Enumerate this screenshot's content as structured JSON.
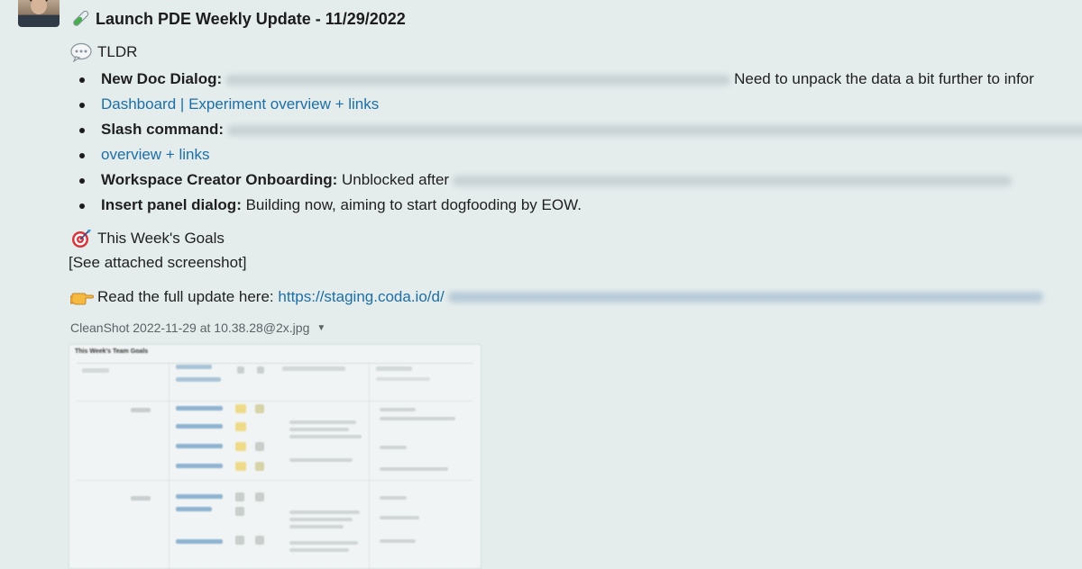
{
  "header": {
    "title": "Launch PDE Weekly Update - 11/29/2022",
    "icon": "test-tube-icon"
  },
  "tldr": {
    "label": "TLDR",
    "icon": "speech-balloon-icon"
  },
  "bullets": [
    {
      "label": "New Doc Dialog:",
      "text_after": "Need to unpack the data a bit further to infor",
      "links": [
        "Dashboard",
        "Experiment overview + links"
      ],
      "separator": "|"
    },
    {
      "label": "Slash command:",
      "link_cont": "overview + links"
    },
    {
      "label": "Workspace Creator Onboarding:",
      "text": "Unblocked after"
    },
    {
      "label": "Insert panel dialog:",
      "text": "Building now, aiming to start dogfooding by EOW."
    }
  ],
  "goals": {
    "label": "This Week's Goals",
    "icon": "dart-target-icon",
    "note": "[See attached screenshot]"
  },
  "read_full": {
    "label": "Read the full update here:",
    "link": "https://staging.coda.io/d/",
    "icon": "pointing-hand-icon"
  },
  "attachment": {
    "filename": "CleanShot 2022-11-29 at 10.38.28@2x.jpg",
    "thumb_title": "This Week's Team Goals"
  },
  "colors": {
    "background": "#e4ecec",
    "link": "#1d6fa5"
  }
}
